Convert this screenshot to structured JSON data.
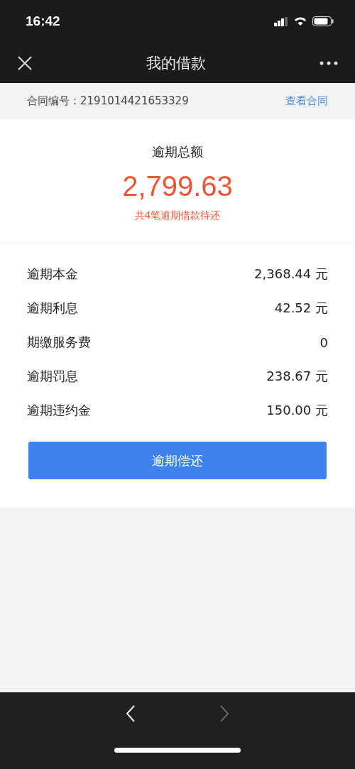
{
  "status_bar": {
    "time": "16:42"
  },
  "nav_bar": {
    "title": "我的借款"
  },
  "contract": {
    "label": "合同编号：",
    "number": "2191014421653329",
    "link": "查看合同"
  },
  "summary": {
    "title": "逾期总额",
    "amount": "2,799.63",
    "note": "共4笔逾期借款待还"
  },
  "details": [
    {
      "label": "逾期本金",
      "value": "2,368.44 元"
    },
    {
      "label": "逾期利息",
      "value": "42.52 元"
    },
    {
      "label": "期缴服务费",
      "value": "0"
    },
    {
      "label": "逾期罚息",
      "value": "238.67 元"
    },
    {
      "label": "逾期违约金",
      "value": "150.00 元"
    }
  ],
  "repay_button": "逾期偿还",
  "browser_toolbar": {
    "back_disabled": false,
    "forward_disabled": true
  }
}
